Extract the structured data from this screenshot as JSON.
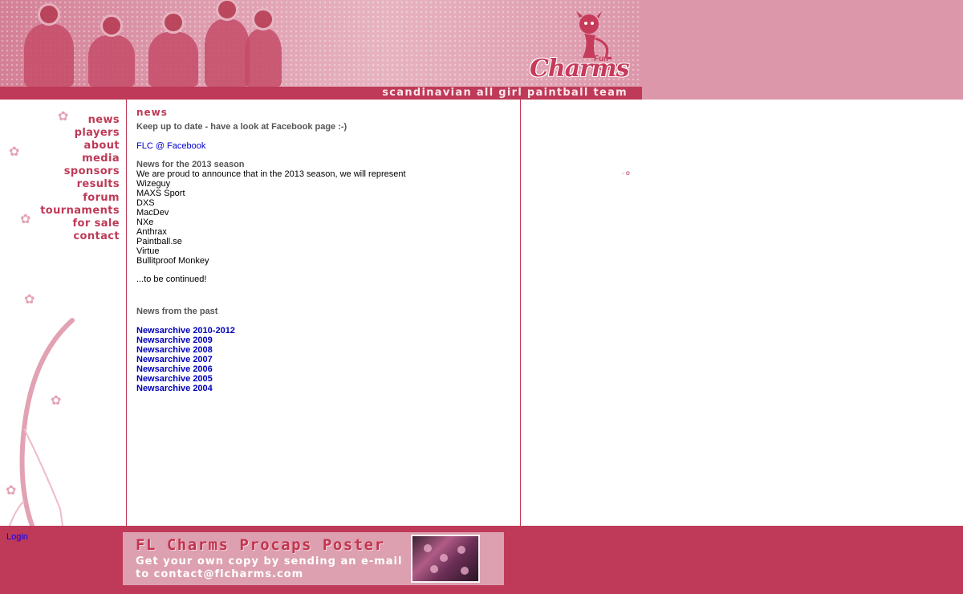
{
  "header": {
    "logo_text": "Charms",
    "logo_sub": "Fun Lovin'",
    "tagline": "scandinavian all girl paintball team"
  },
  "nav": {
    "items": [
      {
        "label": "news"
      },
      {
        "label": "players"
      },
      {
        "label": "about"
      },
      {
        "label": "media"
      },
      {
        "label": "sponsors"
      },
      {
        "label": "results"
      },
      {
        "label": "forum"
      },
      {
        "label": "tournaments"
      },
      {
        "label": "for sale"
      },
      {
        "label": "contact"
      }
    ]
  },
  "content": {
    "title": "news",
    "intro": "Keep up to date - have a look at Facebook page :-)",
    "facebook_link": "FLC @ Facebook",
    "season_heading": "News for the 2013 season",
    "season_text": "We are proud to announce that in the 2013 season, we will represent",
    "sponsors": [
      "Wizeguy",
      "MAXS Sport",
      "DXS",
      "MacDev",
      "NXe",
      "Anthrax",
      "Paintball.se",
      "Virtue",
      "Bullitproof Monkey"
    ],
    "continued": "...to be continued!",
    "past_heading": "News from the past",
    "archives": [
      "Newsarchive 2010-2012",
      "Newsarchive 2009",
      "Newsarchive 2008",
      "Newsarchive 2007",
      "Newsarchive 2006",
      "Newsarchive 2005",
      "Newsarchive 2004"
    ]
  },
  "footer": {
    "login": "Login",
    "banner_title": "FL Charms Procaps Poster",
    "banner_line1": "Get your own copy by sending an e-mail",
    "banner_line2": "to contact@flcharms.com"
  },
  "colors": {
    "brand": "#be3a58",
    "header_bg": "#dc97aa",
    "link": "#0000cc"
  }
}
